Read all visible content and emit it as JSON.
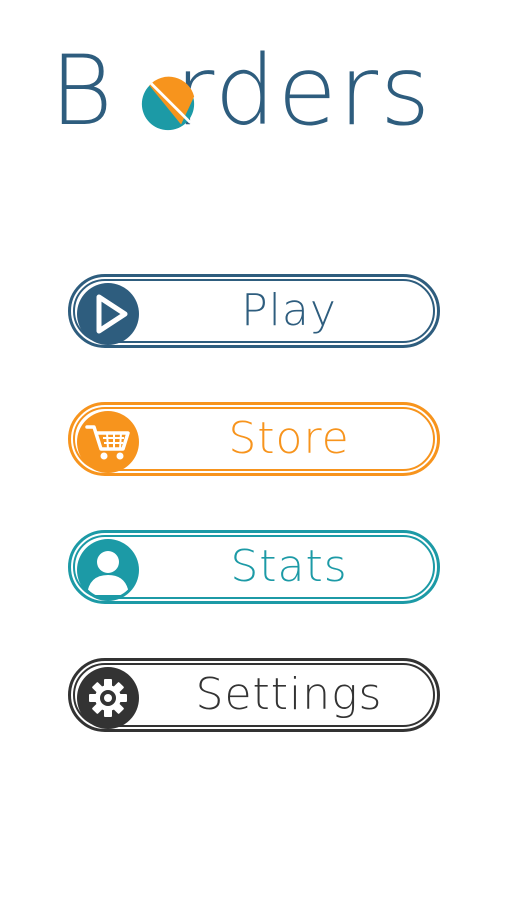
{
  "app": {
    "logo_prefix": "B",
    "logo_suffix": "rders",
    "colors": {
      "primary": "#2e5d7e",
      "accent_orange": "#f7941d",
      "accent_teal": "#1c9aa6",
      "dark": "#333333"
    }
  },
  "menu": {
    "play": {
      "label": "Play",
      "icon": "play-icon"
    },
    "store": {
      "label": "Store",
      "icon": "shopping-cart-icon"
    },
    "stats": {
      "label": "Stats",
      "icon": "user-icon"
    },
    "settings": {
      "label": "Settings",
      "icon": "gear-icon"
    }
  }
}
